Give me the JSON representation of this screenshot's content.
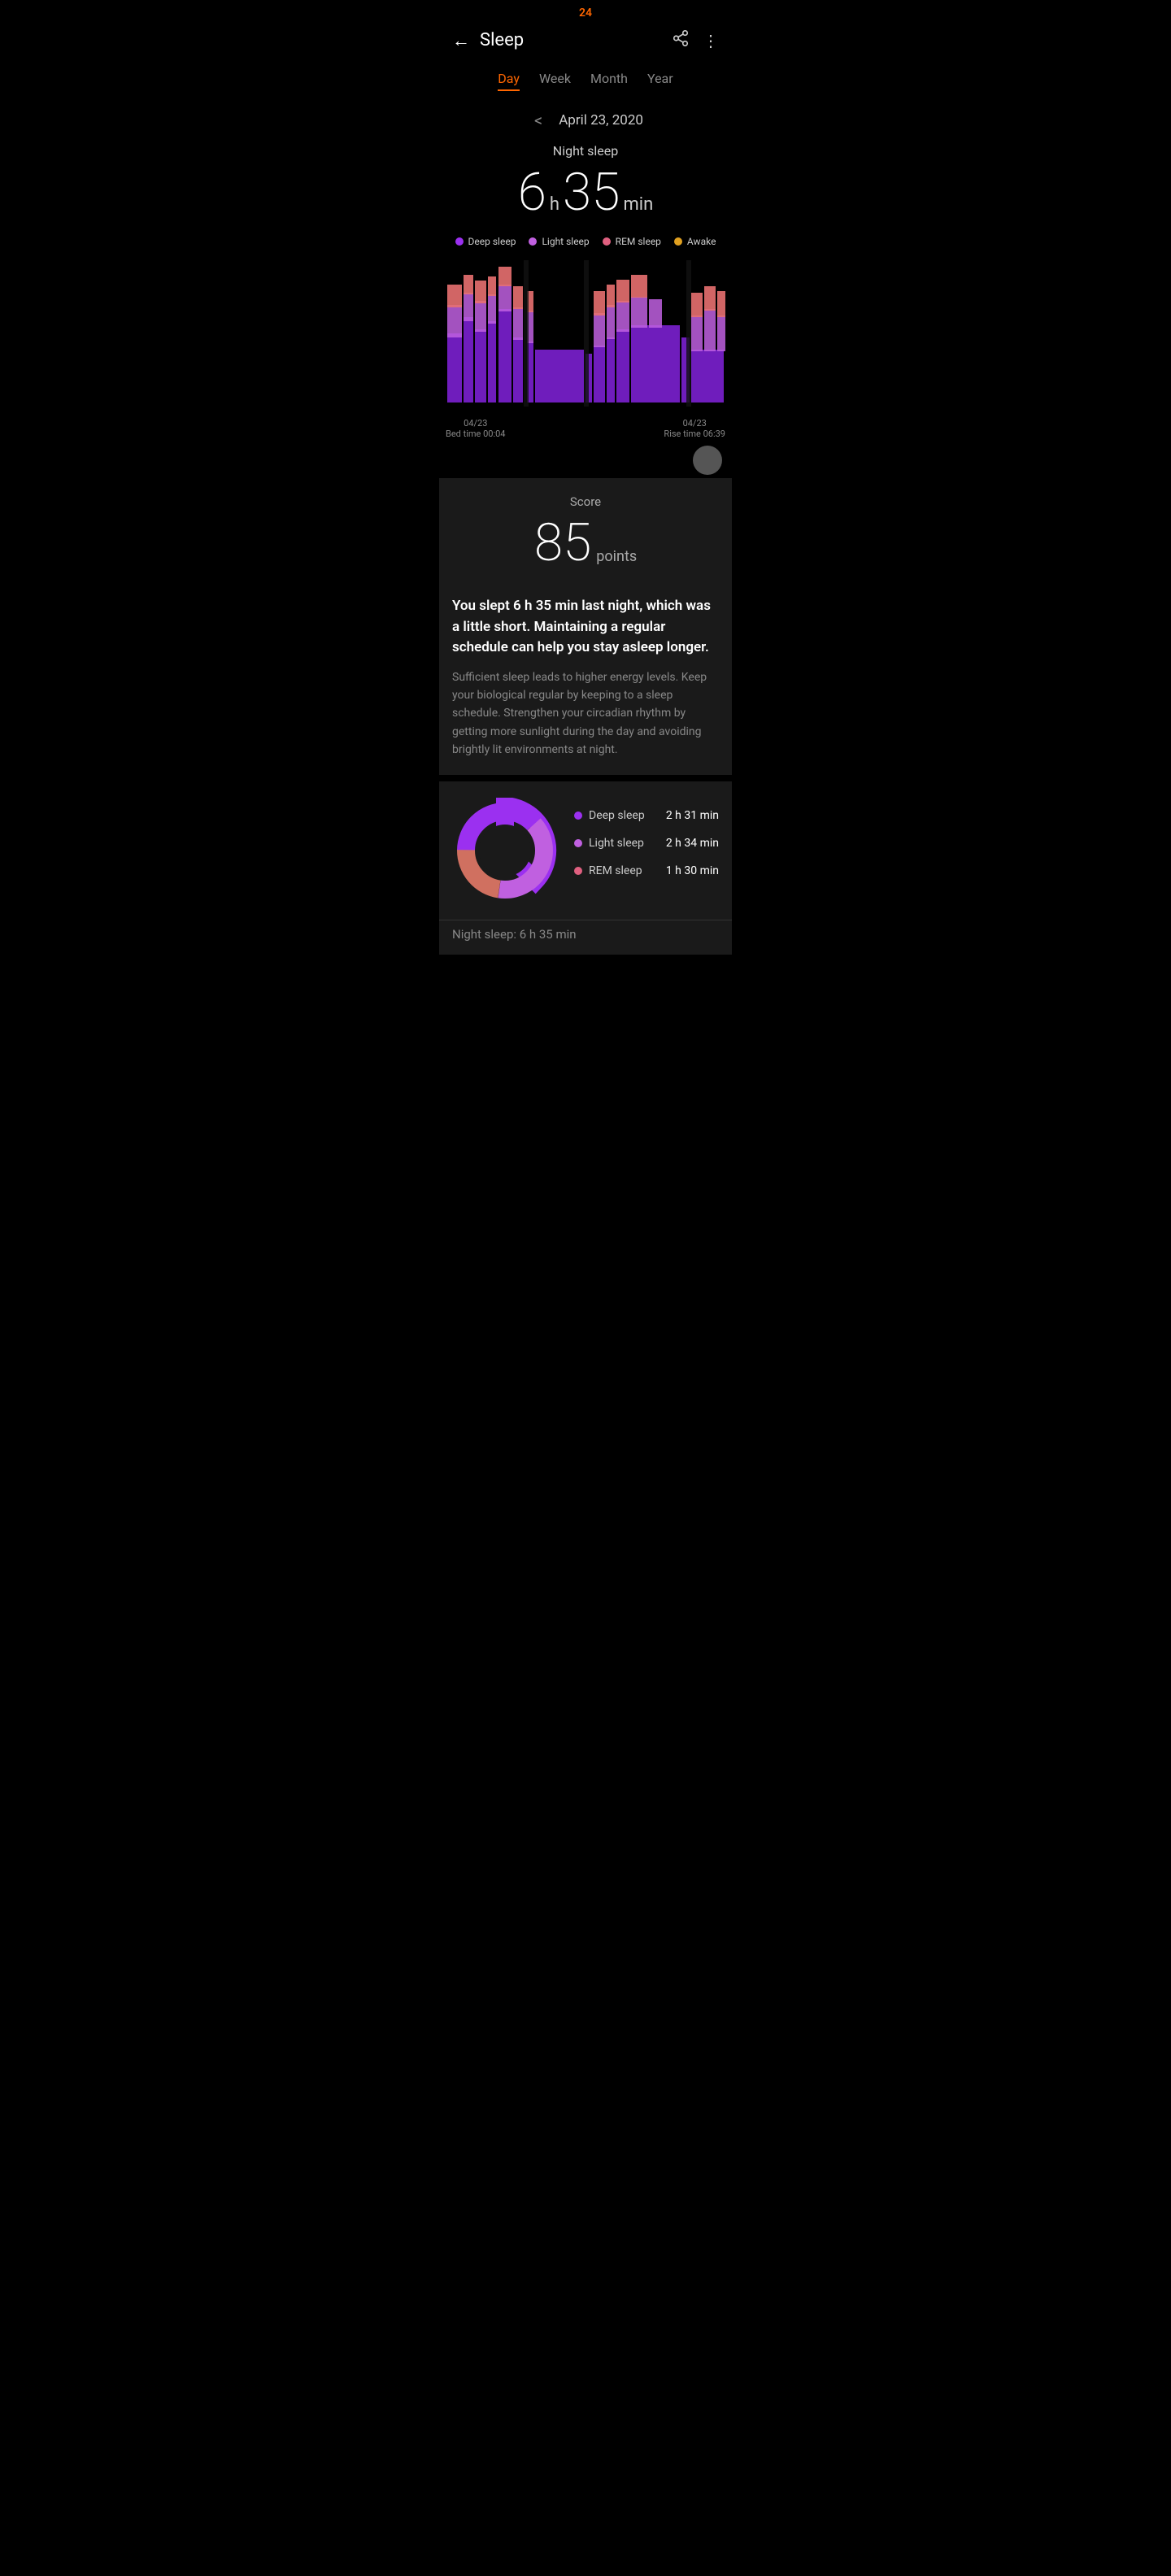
{
  "statusBar": {
    "time": "24"
  },
  "header": {
    "backLabel": "←",
    "title": "Sleep",
    "shareIcon": "share",
    "moreIcon": "more"
  },
  "tabs": [
    {
      "id": "day",
      "label": "Day",
      "active": true
    },
    {
      "id": "week",
      "label": "Week",
      "active": false
    },
    {
      "id": "month",
      "label": "Month",
      "active": false
    },
    {
      "id": "year",
      "label": "Year",
      "active": false
    }
  ],
  "dateNav": {
    "prevArrow": "<",
    "date": "April 23, 2020",
    "nextArrow": ">"
  },
  "sleepSummary": {
    "label": "Night sleep",
    "hours": "6",
    "hoursUnit": "h",
    "minutes": "35",
    "minutesUnit": "min"
  },
  "legend": [
    {
      "label": "Deep sleep",
      "color": "#9b30f0"
    },
    {
      "label": "Light sleep",
      "color": "#c060e0"
    },
    {
      "label": "REM sleep",
      "color": "#e06080"
    },
    {
      "label": "Awake",
      "color": "#e0a020"
    }
  ],
  "chartTimestamps": {
    "left": {
      "date": "04/23",
      "label": "Bed time 00:04"
    },
    "right": {
      "date": "04/23",
      "label": "Rise time 06:39"
    }
  },
  "score": {
    "label": "Score",
    "value": "85",
    "unit": "points"
  },
  "description": {
    "main": "You slept 6 h 35 min last night, which was a little short. Maintaining a regular schedule can help you stay asleep longer.",
    "sub": "Sufficient sleep leads to higher energy levels. Keep your biological regular by keeping to a sleep schedule. Strengthen your circadian rhythm by getting more sunlight during the day and avoiding brightly lit environments at night."
  },
  "pieLegend": [
    {
      "label": "Deep sleep",
      "value": "2 h 31 min",
      "color": "#9b30f0"
    },
    {
      "label": "Light sleep",
      "value": "2 h 34 min",
      "color": "#c060e0"
    },
    {
      "label": "REM sleep",
      "value": "1 h 30 min",
      "color": "#e06080"
    }
  ],
  "bottomTeaser": {
    "text": "Night sleep: 6 h 35 min"
  },
  "colors": {
    "accent": "#ff6600",
    "deepSleep": "#9b30f0",
    "lightSleep": "#c060e0",
    "remSleep": "#e06080",
    "awake": "#e0a020",
    "background": "#000000",
    "surface": "#1a1a1a"
  }
}
